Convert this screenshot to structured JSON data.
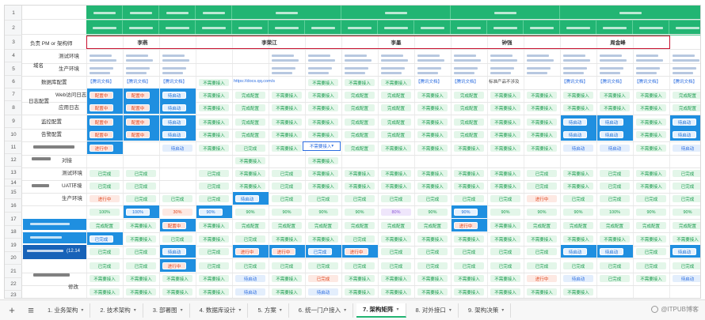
{
  "owner_row": {
    "row_label": "负责 PM or 架构师",
    "owners": [
      "李燕",
      "李荣江",
      "李墨",
      "钟强",
      "周金峰"
    ]
  },
  "row_numbers": [
    "1",
    "2",
    "3",
    "4",
    "5",
    "6",
    "7",
    "8",
    "9",
    "10",
    "11",
    "12",
    "13",
    "14",
    "15",
    "16",
    "17",
    "18",
    "19",
    "20",
    "21",
    "22",
    "23"
  ],
  "labels": {
    "domain": "域名",
    "test_env": "测试环境",
    "prod_env": "生产环境",
    "db_config": "数据库配置",
    "log_config": "日志配置",
    "web_access_log": "Web访问日志",
    "app_log": "应用日志",
    "monitor_config": "监控配置",
    "alert_config": "告警配置",
    "dock": "对接",
    "test_env2": "测试环境",
    "uat_env": "UAT环境",
    "prod_env2": "生产环境",
    "cells_blue_22": "(12.14",
    "review": "修改"
  },
  "links": {
    "tencent_doc": "【腾讯文档】",
    "docs_url": "https://docs.qq.com/s",
    "std_product": "标准产品不涉及"
  },
  "status": {
    "not_needed": "不需要接入",
    "done_config": "完成配置",
    "configuring": "配置中",
    "pending": "待启动",
    "done": "已完成",
    "in_progress": "进行中",
    "p100": "100%",
    "p90": "90%",
    "p80": "80%",
    "p30": "30%"
  },
  "tabs": [
    {
      "label": "1. 业务架构"
    },
    {
      "label": "2. 技术架构"
    },
    {
      "label": "3. 部署图"
    },
    {
      "label": "4. 数据库设计"
    },
    {
      "label": "5. 方案"
    },
    {
      "label": "6. 统一门户接入"
    },
    {
      "label": "7. 架构矩阵"
    },
    {
      "label": "8. 对外接口"
    },
    {
      "label": "9. 架构决策"
    }
  ],
  "active_tab": "7. 架构矩阵",
  "watermark": "@ITPUB博客",
  "colors": {
    "header_green": "#22b573",
    "owner_border": "#c8102e",
    "accent_blue": "#1f8fe0",
    "status_green": "#1a9b4f",
    "status_orange": "#e0461e"
  }
}
